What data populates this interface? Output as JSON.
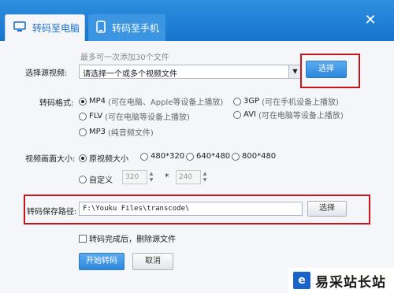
{
  "window": {
    "tabs": [
      {
        "label": "转码至电脑",
        "active": true,
        "icon": "monitor-icon"
      },
      {
        "label": "转码至手机",
        "active": false,
        "icon": "phone-icon"
      }
    ],
    "close_icon": "close-icon",
    "accent": "#1a74cc"
  },
  "source": {
    "hint": "最多可一次添加30个文件",
    "label": "选择源视频:",
    "select_value": "请选择一个或多个视频文件",
    "choose_label": "选择"
  },
  "format": {
    "label": "转码格式:",
    "options": [
      {
        "name": "MP4",
        "note": "(可在电脑、Apple等设备上播放)",
        "checked": true
      },
      {
        "name": "3GP",
        "note": "(可在手机设备上播放)",
        "checked": false
      },
      {
        "name": "FLV",
        "note": "(可在电脑等设备上播放)",
        "checked": false
      },
      {
        "name": "AVI",
        "note": "(可在电脑等设备上播放)",
        "checked": false
      },
      {
        "name": "MP3",
        "note": "(纯音频文件)",
        "checked": false
      }
    ]
  },
  "size": {
    "label": "视频画面大小:",
    "options": [
      {
        "name": "原视频大小",
        "checked": true
      },
      {
        "name": "480*320",
        "checked": false
      },
      {
        "name": "640*480",
        "checked": false
      },
      {
        "name": "800*480",
        "checked": false
      }
    ],
    "custom_label": "自定义",
    "width_value": "320",
    "times": "*",
    "height_value": "240"
  },
  "save": {
    "label": "转码保存路径:",
    "path": "F:\\Youku Files\\transcode\\",
    "choose_label": "选择"
  },
  "delete_source": {
    "label": "转码完成后，删除源文件",
    "checked": false
  },
  "actions": {
    "start_label": "开始转码",
    "cancel_label": "取消"
  },
  "watermark": {
    "logo": "e",
    "text": "易采站长站"
  },
  "highlight_color": "#c8151b"
}
